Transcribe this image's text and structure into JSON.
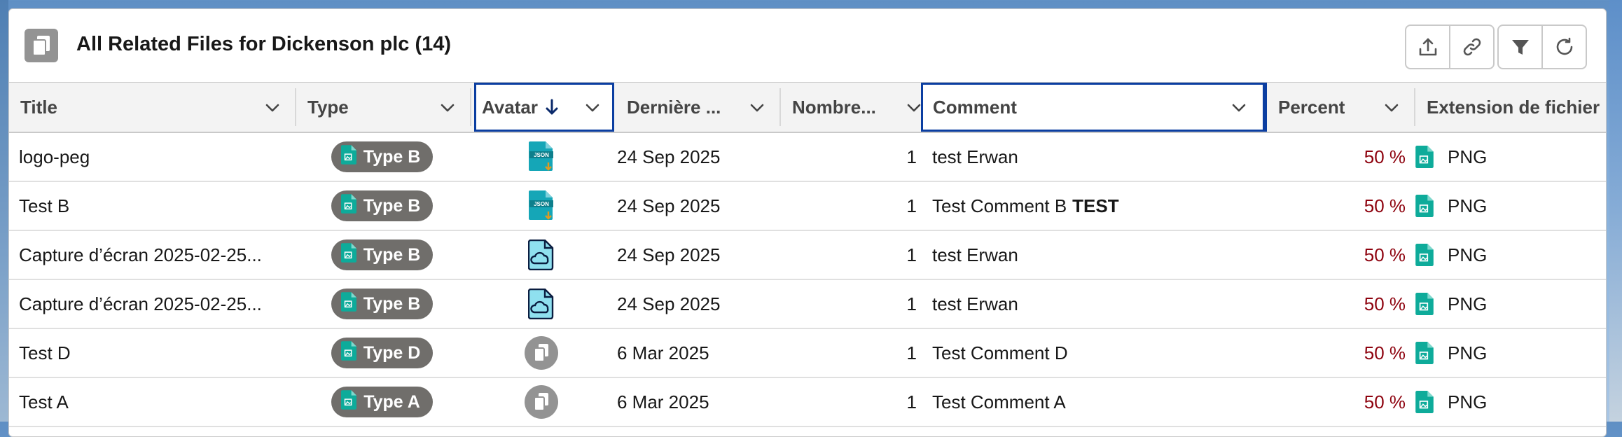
{
  "header": {
    "title": "All Related Files for Dickenson plc (14)",
    "icon": "files-icon",
    "actions": [
      {
        "name": "upload-icon"
      },
      {
        "name": "link-icon"
      },
      {
        "name": "filter-icon"
      },
      {
        "name": "refresh-icon"
      }
    ]
  },
  "columns": {
    "title": "Title",
    "type": "Type",
    "avatar": "Avatar",
    "date": "Dernière ...",
    "nombre": "Nombre...",
    "comment": "Comment",
    "percent": "Percent",
    "extension": "Extension de fichier"
  },
  "rows": [
    {
      "title": "logo-peg",
      "type": "Type B",
      "avatar": "json-file-icon",
      "date": "24 Sep 2025",
      "nombre": "1",
      "comment": "test Erwan",
      "comment_bold": "",
      "percent": "50 %",
      "extension": "PNG"
    },
    {
      "title": "Test B",
      "type": "Type B",
      "avatar": "json-file-icon",
      "date": "24 Sep 2025",
      "nombre": "1",
      "comment": "Test Comment B",
      "comment_bold": "TEST",
      "percent": "50 %",
      "extension": "PNG"
    },
    {
      "title": "Capture d’écran 2025-02-25...",
      "type": "Type B",
      "avatar": "cloud-file-icon",
      "date": "24 Sep 2025",
      "nombre": "1",
      "comment": "test Erwan",
      "comment_bold": "",
      "percent": "50 %",
      "extension": "PNG"
    },
    {
      "title": "Capture d’écran 2025-02-25...",
      "type": "Type B",
      "avatar": "cloud-file-icon",
      "date": "24 Sep 2025",
      "nombre": "1",
      "comment": "test Erwan",
      "comment_bold": "",
      "percent": "50 %",
      "extension": "PNG"
    },
    {
      "title": "Test D",
      "type": "Type D",
      "avatar": "generic-file-icon",
      "date": "6 Mar 2025",
      "nombre": "1",
      "comment": "Test Comment D",
      "comment_bold": "",
      "percent": "50 %",
      "extension": "PNG"
    },
    {
      "title": "Test A",
      "type": "Type A",
      "avatar": "generic-file-icon",
      "date": "6 Mar 2025",
      "nombre": "1",
      "comment": "Test Comment A",
      "comment_bold": "",
      "percent": "50 %",
      "extension": "PNG"
    }
  ],
  "colors": {
    "percent": "#8e030f",
    "pill": "#706e6b",
    "focus_border": "#0b3ea1",
    "file_teal": "#0eab9a"
  }
}
